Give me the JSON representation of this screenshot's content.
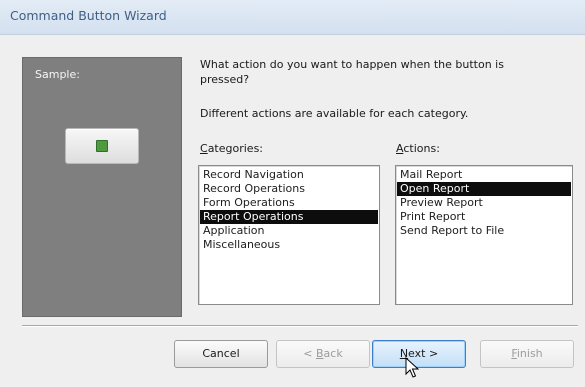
{
  "window": {
    "title": "Command Button Wizard"
  },
  "sample": {
    "label": "Sample:"
  },
  "question": "What action do you want to happen when the button is pressed?",
  "info": "Different actions are available for each category.",
  "categories": {
    "label_first": "C",
    "label_rest": "ategories:",
    "items": [
      "Record Navigation",
      "Record Operations",
      "Form Operations",
      "Report Operations",
      "Application",
      "Miscellaneous"
    ],
    "selected": "Report Operations"
  },
  "actions": {
    "label_first": "A",
    "label_rest": "ctions:",
    "items": [
      "Mail Report",
      "Open Report",
      "Preview Report",
      "Print Report",
      "Send Report to File"
    ],
    "selected": "Open Report"
  },
  "buttons": {
    "cancel": "Cancel",
    "back_prefix": "< ",
    "back_key": "B",
    "back_rest": "ack",
    "next_key": "N",
    "next_rest": "ext >",
    "finish_key": "F",
    "finish_rest": "inish"
  },
  "icons": {
    "sample": "green-square-icon",
    "cursor": "arrow-cursor-icon"
  }
}
